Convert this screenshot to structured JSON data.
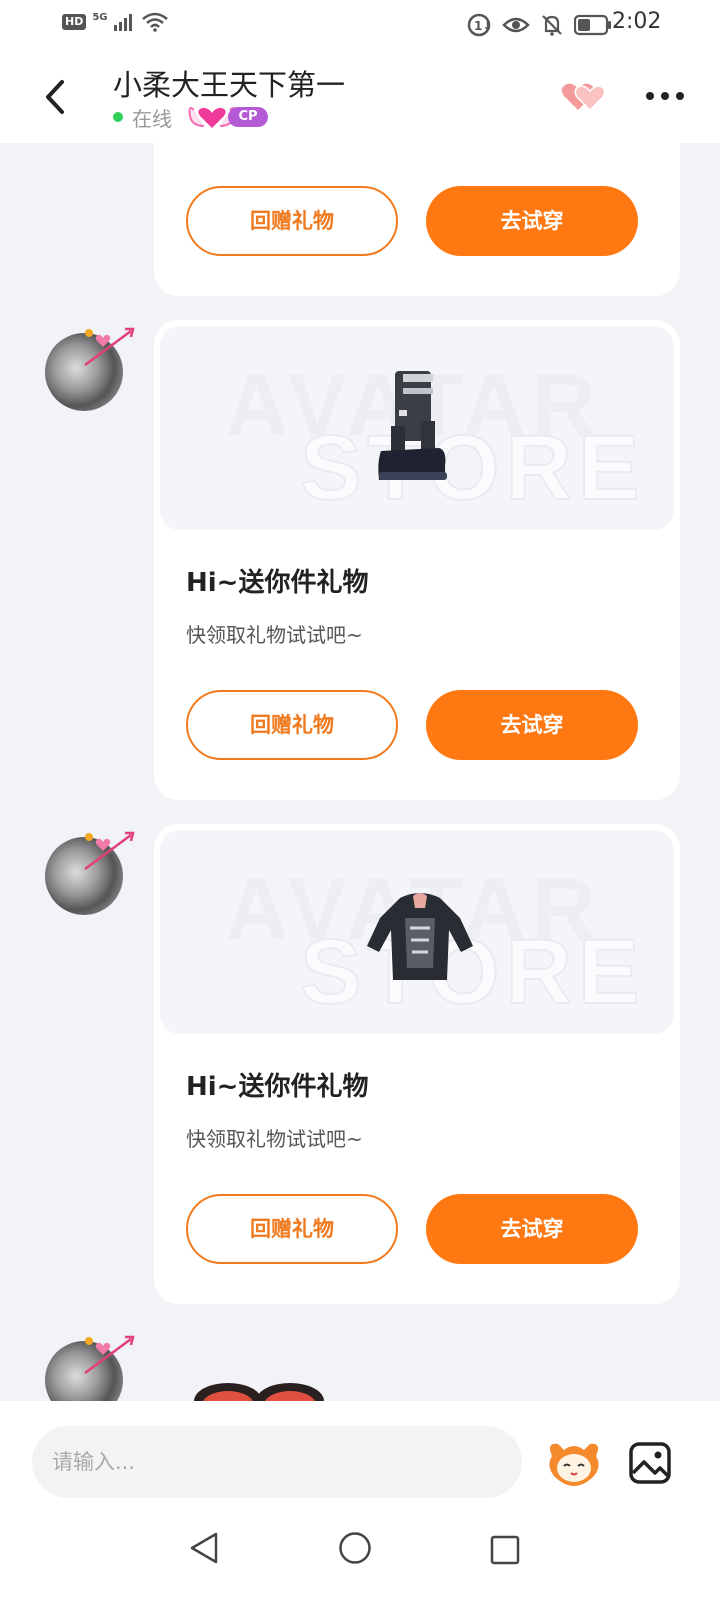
{
  "status_bar": {
    "hd": "HD",
    "network": "5G",
    "time": "2:02"
  },
  "header": {
    "title": "小柔大王天下第一",
    "status": "在线",
    "cp_badge": "CP"
  },
  "messages": [
    {
      "title": "Hi~送你件礼物",
      "subtitle": "快领取礼物试试吧~",
      "item": "boots-icon",
      "secondary_button": "回赠礼物",
      "primary_button": "去试穿"
    },
    {
      "title": "Hi~送你件礼物",
      "subtitle": "快领取礼物试试吧~",
      "item": "hoodie-icon",
      "secondary_button": "回赠礼物",
      "primary_button": "去试穿"
    }
  ],
  "partial_card": {
    "secondary_button": "回赠礼物",
    "primary_button": "去试穿"
  },
  "watermark": {
    "line1": "AVATAR",
    "line2": "STORE"
  },
  "input": {
    "placeholder": "请输入..."
  },
  "colors": {
    "accent": "#ff7812",
    "online": "#2fcf5a",
    "cp": "#b45ad6"
  }
}
